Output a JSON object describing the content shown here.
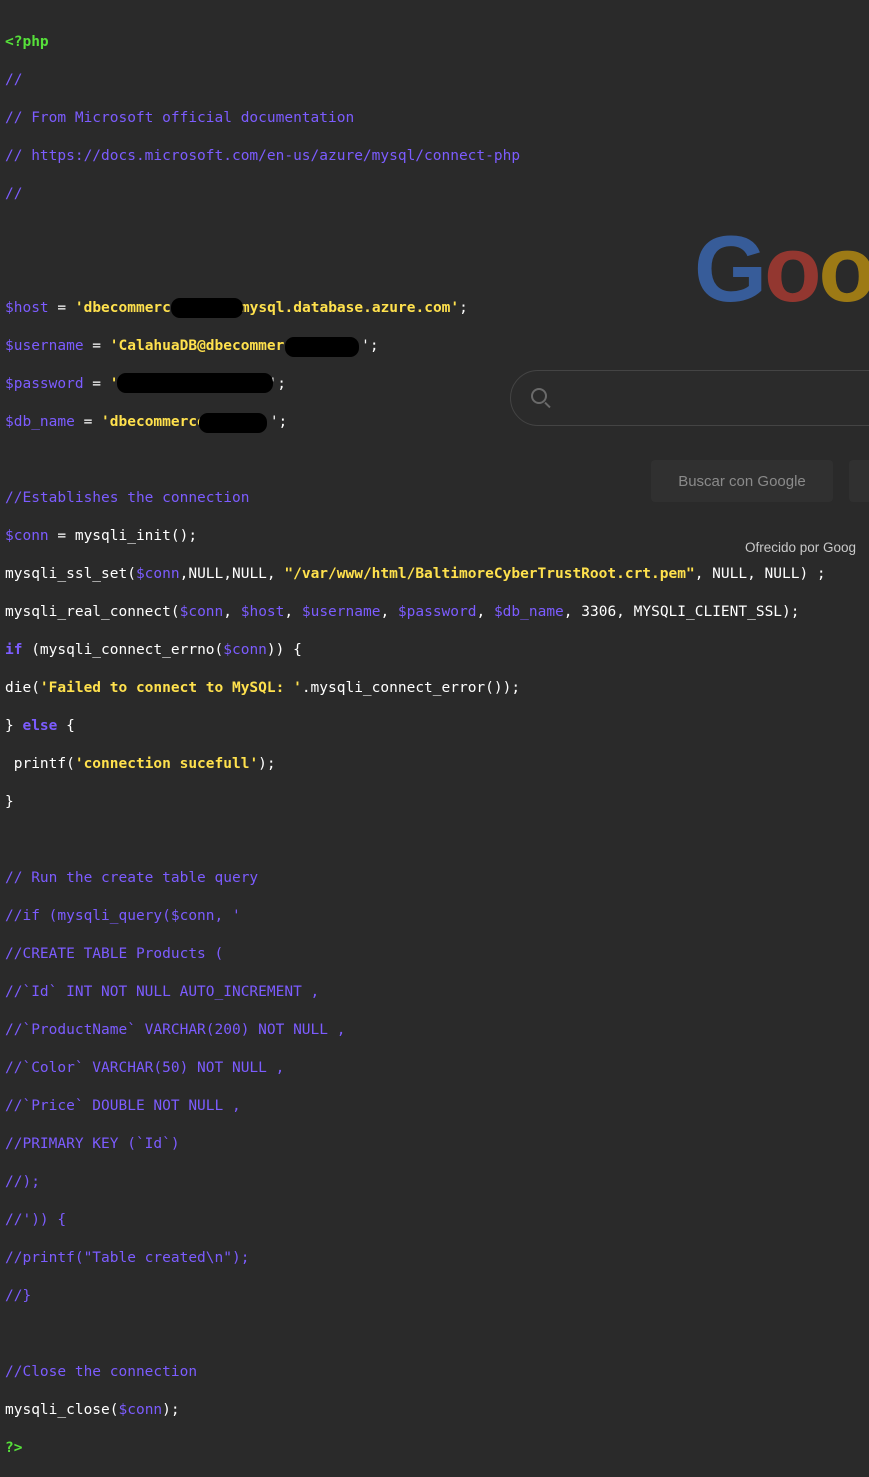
{
  "google": {
    "logo_letters": [
      "G",
      "o",
      "o"
    ],
    "search_button": "Buscar con Google",
    "offered_by": "Ofrecido por Goog"
  },
  "code": {
    "l1": "<?php",
    "l2": "//",
    "l3": "// From Microsoft official documentation",
    "l4": "// https://docs.microsoft.com/en-us/azure/mysql/connect-php",
    "l5": "//",
    "host_var": "$host",
    "host_eq": " = ",
    "host_val_a": "'dbecommerc",
    "host_val_b": "mysql.database.azure.com'",
    "host_end": ";",
    "user_var": "$username",
    "user_eq": " = ",
    "user_val": "'CalahuaDB@dbecommerc",
    "user_end": "';",
    "pass_var": "$password",
    "pass_eq": " = ",
    "pass_val": "'",
    "pass_end": "';",
    "db_var": "$db_name",
    "db_eq": " = ",
    "db_val": "'dbecommerce",
    "db_end": "';",
    "c1": "//Establishes the connection",
    "conn_var": "$conn",
    "conn_rest": " = mysqli_init();",
    "ssl_a": "mysqli_ssl_set(",
    "ssl_var": "$conn",
    "ssl_b": ",NULL,NULL, ",
    "ssl_str": "\"/var/www/html/BaltimoreCyberTrustRoot.crt.pem\"",
    "ssl_c": ", NULL, NULL) ;",
    "rc_a": "mysqli_real_connect(",
    "rc_v1": "$conn",
    "rc_s1": ", ",
    "rc_v2": "$host",
    "rc_s2": ", ",
    "rc_v3": "$username",
    "rc_s3": ", ",
    "rc_v4": "$password",
    "rc_s4": ", ",
    "rc_v5": "$db_name",
    "rc_b": ", 3306, MYSQLI_CLIENT_SSL);",
    "if_kw": "if",
    "if_a": " (mysqli_connect_errno(",
    "if_var": "$conn",
    "if_b": ")) {",
    "die_a": "die(",
    "die_str": "'Failed to connect to MySQL: '",
    "die_b": ".mysqli_connect_error());",
    "else_a": "} ",
    "else_kw": "else",
    "else_b": " {",
    "pf_a": " printf(",
    "pf_str": "'connection sucefull'",
    "pf_b": ");",
    "close_brace": "}",
    "cm1": "// Run the create table query",
    "cm2": "//if (mysqli_query($conn, '",
    "cm3": "//CREATE TABLE Products (",
    "cm4": "//`Id` INT NOT NULL AUTO_INCREMENT ,",
    "cm5": "//`ProductName` VARCHAR(200) NOT NULL ,",
    "cm6": "//`Color` VARCHAR(50) NOT NULL ,",
    "cm7": "//`Price` DOUBLE NOT NULL ,",
    "cm8": "//PRIMARY KEY (`Id`)",
    "cm9": "//);",
    "cm10": "//')) {",
    "cm11": "//printf(\"Table created\\n\");",
    "cm12": "//}",
    "cm13": "//Close the connection",
    "mc_a": "mysqli_close(",
    "mc_var": "$conn",
    "mc_b": ");",
    "end": "?>"
  }
}
